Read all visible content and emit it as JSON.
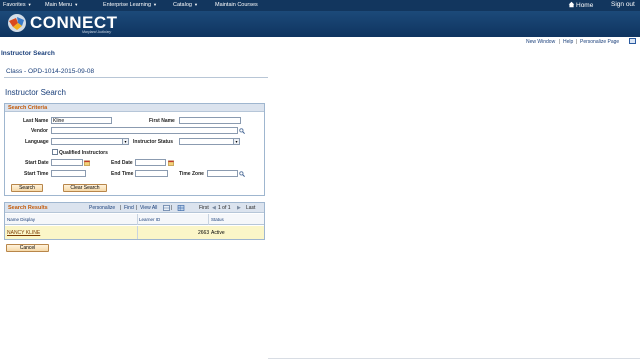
{
  "nav": {
    "items": [
      "Favorites",
      "Main Menu",
      "Enterprise Learning",
      "Catalog",
      "Maintain Courses"
    ],
    "home": "Home",
    "signout": "Sign out"
  },
  "brand": {
    "name": "CONNECT",
    "subtitle": "Maryland Judiciary"
  },
  "util": {
    "new_window": "New Window",
    "help": "Help",
    "personalize": "Personalize Page",
    "sep": "|"
  },
  "page": {
    "title": "Instructor Search",
    "class_label": "Class - OPD-1014-2015-09-08",
    "section_title": "Instructor Search"
  },
  "criteria": {
    "title": "Search Criteria",
    "last_name_label": "Last Name",
    "last_name_value": "Kline",
    "first_name_label": "First Name",
    "first_name_value": "",
    "vendor_label": "Vendor",
    "language_label": "Language",
    "instructor_status_label": "Instructor Status",
    "qualified_label": "Qualified Instructors",
    "start_date_label": "Start Date",
    "end_date_label": "End Date",
    "start_time_label": "Start Time",
    "end_time_label": "End Time",
    "time_zone_label": "Time Zone",
    "search_button": "Search",
    "clear_button": "Clear Search"
  },
  "results": {
    "title": "Search Results",
    "personalize": "Personalize",
    "find": "Find",
    "view_all": "View All",
    "first": "First",
    "range": "1 of 1",
    "last": "Last",
    "columns": [
      "Name Display",
      "Learner ID",
      "Status"
    ],
    "rows": [
      {
        "name": "NANCY KLINE",
        "learner_id": "2663",
        "status": "Active"
      }
    ]
  },
  "cancel_button": "Cancel",
  "colors": {
    "nav_bg": "#12365e",
    "section_orange": "#c35a0a",
    "link_blue": "#1a3f7a",
    "row_highlight": "#fbf6c8"
  }
}
